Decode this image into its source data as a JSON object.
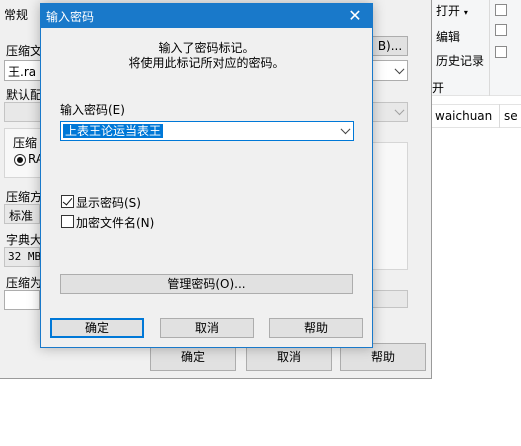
{
  "explorer": {
    "open_label": "打开",
    "edit_label": "编辑",
    "history_label": "历史记录",
    "group_label": "开",
    "path_segment": "waichuan",
    "path_segment_next": "se"
  },
  "archive_dialog": {
    "tab_general": "常规",
    "archive_name_label": "压缩文",
    "archive_name_value": "王.ra",
    "browse_button": "B)...",
    "default_profile_label": "默认配",
    "format_group_label": "压缩",
    "format_option": "RA",
    "method_label": "压缩方",
    "method_value": "标准",
    "dict_label": "字典大",
    "dict_value": "32 MB",
    "volume_label": "压缩为",
    "ok_button": "确定",
    "cancel_button": "取消",
    "help_button": "帮助"
  },
  "password_dialog": {
    "title": "输入密码",
    "close_symbol": "✕",
    "message_line1": "输入了密码标记。",
    "message_line2": "将使用此标记所对应的密码。",
    "password_label": "输入密码(E)",
    "password_value": "上表王论运当表王",
    "show_password_label": "显示密码(S)",
    "show_password_checked": true,
    "encrypt_names_label": "加密文件名(N)",
    "encrypt_names_checked": false,
    "manage_button": "管理密码(O)...",
    "ok_button": "确定",
    "cancel_button": "取消",
    "help_button": "帮助"
  },
  "colors": {
    "title_bar": "#1979ca",
    "selection": "#0078d7",
    "dialog_bg": "#f0f0f0"
  }
}
